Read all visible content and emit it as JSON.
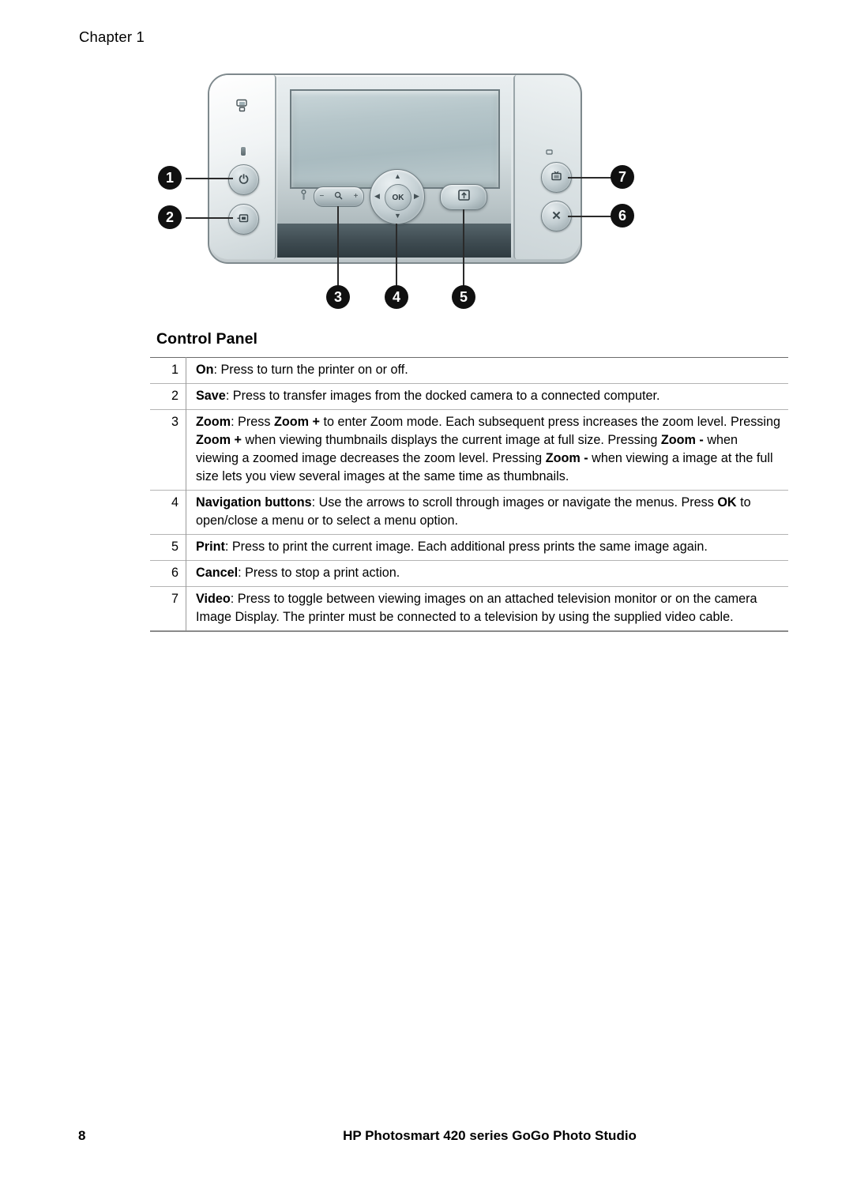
{
  "page": {
    "chapter_label": "Chapter 1",
    "folio": "8",
    "footer_title": "HP Photosmart 420 series GoGo Photo Studio"
  },
  "figure": {
    "caption_numbers": [
      "1",
      "2",
      "3",
      "4",
      "5",
      "6",
      "7"
    ],
    "controls": {
      "dock_icon": "dock-printer-icon",
      "power_glyph": "⏻",
      "save_glyph": "⎙",
      "video_glyph": "TV",
      "cancel_glyph": "✕",
      "zoom_minus": "−",
      "zoom_magnifier": "Q",
      "zoom_plus": "+",
      "ok_label": "OK",
      "nav_up": "▲",
      "nav_down": "▼",
      "nav_left": "◀",
      "nav_right": "▶",
      "print_glyph": "print-icon"
    }
  },
  "section": {
    "title": "Control Panel"
  },
  "table": {
    "rows": [
      {
        "num": "1",
        "parts": [
          {
            "text": "On",
            "bold": true
          },
          {
            "text": ": Press to turn the printer on or off.",
            "bold": false
          }
        ]
      },
      {
        "num": "2",
        "parts": [
          {
            "text": "Save",
            "bold": true
          },
          {
            "text": ": Press to transfer images from the docked camera to a connected computer.",
            "bold": false
          }
        ]
      },
      {
        "num": "3",
        "parts": [
          {
            "text": "Zoom",
            "bold": true
          },
          {
            "text": ": Press ",
            "bold": false
          },
          {
            "text": "Zoom +",
            "bold": true
          },
          {
            "text": " to enter Zoom mode. Each subsequent press increases the zoom level. Pressing ",
            "bold": false
          },
          {
            "text": "Zoom +",
            "bold": true
          },
          {
            "text": " when viewing thumbnails displays the current image at full size. Pressing ",
            "bold": false
          },
          {
            "text": "Zoom -",
            "bold": true
          },
          {
            "text": " when viewing a zoomed image decreases the zoom level. Pressing ",
            "bold": false
          },
          {
            "text": "Zoom -",
            "bold": true
          },
          {
            "text": " when viewing a image at the full size lets you view several images at the same time as thumbnails.",
            "bold": false
          }
        ]
      },
      {
        "num": "4",
        "parts": [
          {
            "text": "Navigation buttons",
            "bold": true
          },
          {
            "text": ": Use the arrows to scroll through images or navigate the menus. Press ",
            "bold": false
          },
          {
            "text": "OK",
            "bold": true
          },
          {
            "text": " to open/close a menu or to select a menu option.",
            "bold": false
          }
        ]
      },
      {
        "num": "5",
        "parts": [
          {
            "text": "Print",
            "bold": true
          },
          {
            "text": ": Press to print the current image. Each additional press prints the same image again.",
            "bold": false
          }
        ]
      },
      {
        "num": "6",
        "parts": [
          {
            "text": "Cancel",
            "bold": true
          },
          {
            "text": ": Press to stop a print action.",
            "bold": false
          }
        ]
      },
      {
        "num": "7",
        "parts": [
          {
            "text": "Video",
            "bold": true
          },
          {
            "text": ": Press to toggle between viewing images on an attached television monitor or on the camera Image Display. The printer must be connected to a television by using the supplied video cable.",
            "bold": false
          }
        ]
      }
    ]
  }
}
